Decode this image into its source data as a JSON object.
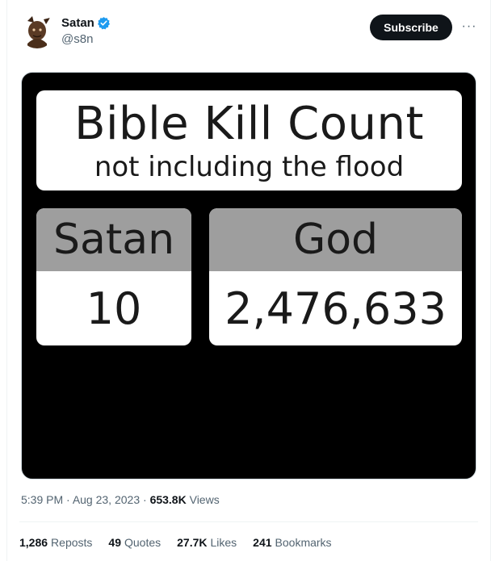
{
  "author": {
    "display_name": "Satan",
    "handle": "@s8n",
    "verified": true
  },
  "header": {
    "subscribe_label": "Subscribe",
    "more_label": "···"
  },
  "media": {
    "title": "Bible Kill Count",
    "subtitle": "not including the flood",
    "cards": [
      {
        "name": "Satan",
        "value": "10"
      },
      {
        "name": "God",
        "value": "2,476,633"
      }
    ]
  },
  "meta": {
    "time": "5:39 PM",
    "separator": "·",
    "date": "Aug 23, 2023",
    "views_count": "653.8K",
    "views_label": "Views"
  },
  "stats": [
    {
      "count": "1,286",
      "label": "Reposts"
    },
    {
      "count": "49",
      "label": "Quotes"
    },
    {
      "count": "27.7K",
      "label": "Likes"
    },
    {
      "count": "241",
      "label": "Bookmarks"
    }
  ],
  "colors": {
    "verified_badge": "#1d9bf0",
    "button_bg": "#0f1419",
    "secondary_text": "#536471",
    "card_header_gray": "#9e9e9e"
  }
}
